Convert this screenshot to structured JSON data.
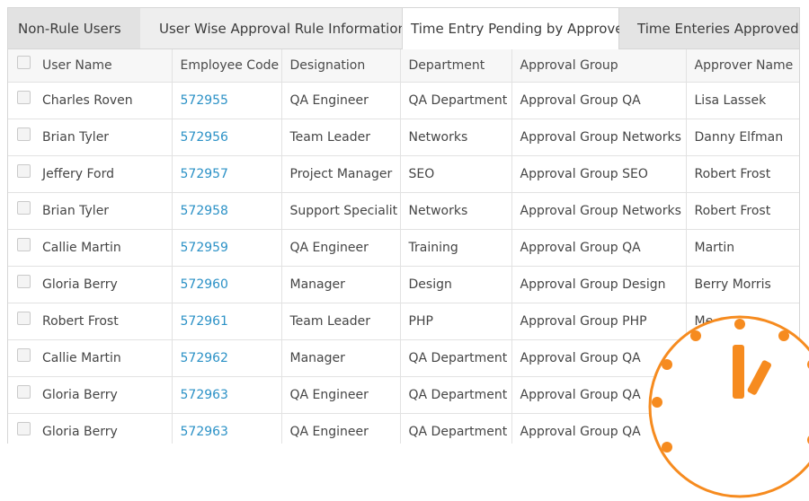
{
  "tabs": [
    {
      "label": "Non-Rule Users"
    },
    {
      "label": "User Wise Approval Rule Information"
    },
    {
      "label": "Time Entry Pending by Approver"
    },
    {
      "label": "Time Enteries Approved"
    }
  ],
  "active_tab": "Time Entry Pending by Approver",
  "table": {
    "columns": [
      "User Name",
      "Employee Code",
      "Designation",
      "Department",
      "Approval Group",
      "Approver Name"
    ],
    "rows": [
      [
        "Charles Roven",
        "572955",
        "QA Engineer",
        "QA Department",
        "Approval Group QA",
        "Lisa Lassek"
      ],
      [
        "Brian Tyler",
        "572956",
        "Team Leader",
        "Networks",
        "Approval Group Networks",
        "Danny Elfman"
      ],
      [
        "Jeffery Ford",
        "572957",
        "Project Manager",
        "SEO",
        "Approval Group SEO",
        "Robert Frost"
      ],
      [
        "Brian Tyler",
        "572958",
        "Support Specialit",
        "Networks",
        "Approval Group Networks",
        "Robert Frost"
      ],
      [
        "Callie Martin",
        "572959",
        "QA Engineer",
        "Training",
        "Approval Group QA",
        "Martin"
      ],
      [
        "Gloria Berry",
        "572960",
        "Manager",
        "Design",
        "Approval Group Design",
        "Berry Morris"
      ],
      [
        "Robert Frost",
        "572961",
        "Team Leader",
        "PHP",
        "Approval Group PHP",
        "Me"
      ],
      [
        "Callie Martin",
        "572962",
        "Manager",
        "QA Department",
        "Approval Group QA",
        ""
      ],
      [
        "Gloria Berry",
        "572963",
        "QA Engineer",
        "QA Department",
        "Approval Group QA",
        ""
      ],
      [
        "Gloria Berry",
        "572963",
        "QA Engineer",
        "QA Department",
        "Approval Group QA",
        ""
      ]
    ]
  },
  "colors": {
    "accent_orange": "#f68b1f",
    "link_blue": "#2b91c6",
    "tab_bar": "#e4e4e4"
  },
  "icons": {
    "checkbox": "checkbox-icon",
    "clock": "clock-icon"
  }
}
